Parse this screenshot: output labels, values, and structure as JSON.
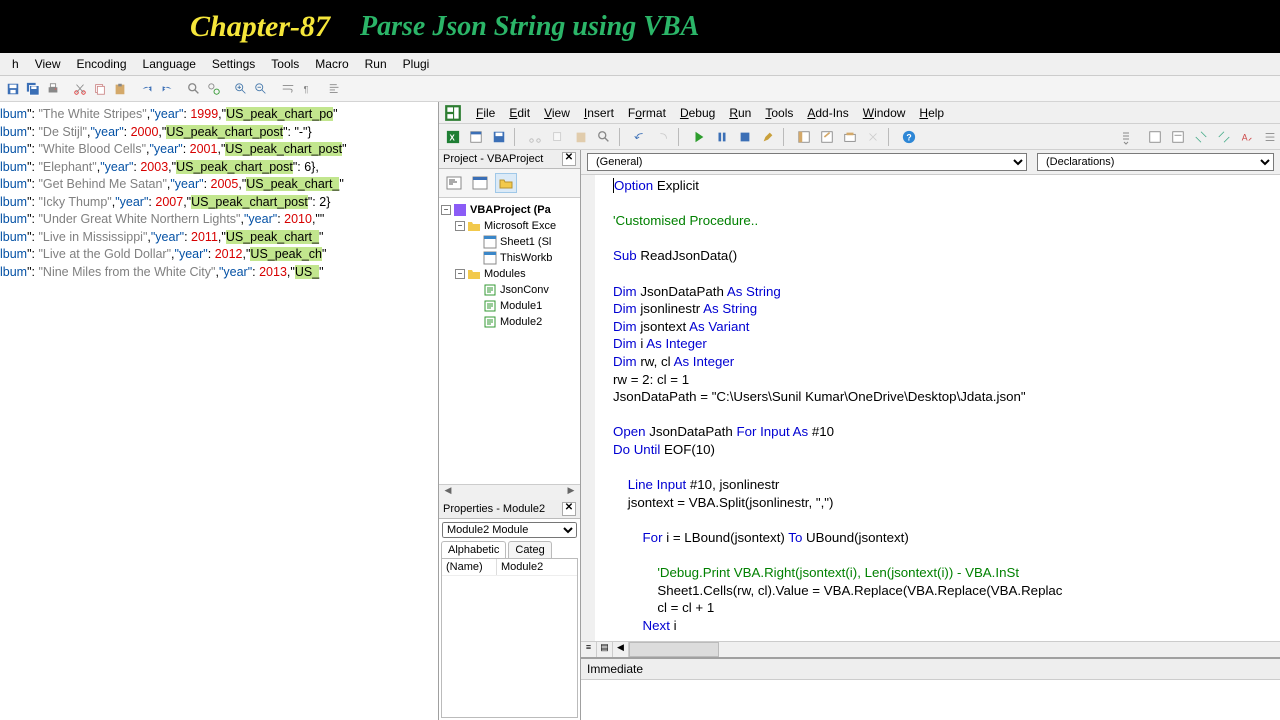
{
  "header": {
    "chapter": "Chapter-87",
    "subtitle": "Parse Json String using VBA"
  },
  "npp": {
    "menus": [
      "h",
      "View",
      "Encoding",
      "Language",
      "Settings",
      "Tools",
      "Macro",
      "Run",
      "Plugi"
    ],
    "json_lines": [
      {
        "key": "lbum",
        "album": "The White Stripes",
        "year": 1999,
        "peak_hl": "US_peak_chart_po"
      },
      {
        "key": "lbum",
        "album": "De Stijl",
        "year": 2000,
        "peak_hl": "US_peak_chart_post",
        "tail": ": \"-\"}"
      },
      {
        "key": "lbum",
        "album": "White Blood Cells",
        "year": 2001,
        "peak_hl": "US_peak_chart_post"
      },
      {
        "key": "lbum",
        "album": "Elephant",
        "year": 2003,
        "peak_hl": "US_peak_chart_post",
        "tail": ": 6},"
      },
      {
        "key": "lbum",
        "album": "Get Behind Me Satan",
        "year": 2005,
        "peak_hl": "US_peak_chart_"
      },
      {
        "key": "lbum",
        "album": "Icky Thump",
        "year": 2007,
        "peak_hl": "US_peak_chart_post",
        "tail": ": 2}"
      },
      {
        "key": "lbum",
        "album": "Under Great White Northern Lights",
        "year": 2010,
        "tail_hl": ""
      },
      {
        "key": "lbum",
        "album": "Live in Mississippi",
        "year": 2011,
        "peak_hl": "US_peak_chart_"
      },
      {
        "key": "lbum",
        "album": "Live at the Gold Dollar",
        "year": 2012,
        "peak_hl": "US_peak_ch"
      },
      {
        "key": "lbum",
        "album": "Nine Miles from the White City",
        "year": 2013,
        "peak_hl": "US_"
      }
    ]
  },
  "vbe": {
    "menus": [
      "File",
      "Edit",
      "View",
      "Insert",
      "Format",
      "Debug",
      "Run",
      "Tools",
      "Add-Ins",
      "Window",
      "Help"
    ],
    "project_title": "Project - VBAProject",
    "tree": {
      "root": "VBAProject (Pa",
      "excel_folder": "Microsoft Exce",
      "sheet1": "Sheet1 (Sl",
      "thiswb": "ThisWorkb",
      "modules": "Modules",
      "mod_items": [
        "JsonConv",
        "Module1",
        "Module2"
      ]
    },
    "properties_title": "Properties - Module2",
    "props_combo": "Module2 Module",
    "props_tabs": [
      "Alphabetic",
      "Categ"
    ],
    "props_name_k": "(Name)",
    "props_name_v": "Module2",
    "combo_left": "(General)",
    "combo_right": "(Declarations)",
    "immediate_title": "Immediate",
    "code": {
      "l1_a": "Option",
      "l1_b": " Explicit",
      "l2": "'Customised Procedure..",
      "l3_a": "Sub",
      "l3_b": " ReadJsonData()",
      "l4_a": "Dim",
      "l4_b": " JsonDataPath ",
      "l4_c": "As String",
      "l5_a": "Dim",
      "l5_b": " jsonlinestr ",
      "l5_c": "As String",
      "l6_a": "Dim",
      "l6_b": " jsontext ",
      "l6_c": "As Variant",
      "l7_a": "Dim",
      "l7_b": " i ",
      "l7_c": "As Integer",
      "l8_a": "Dim",
      "l8_b": " rw, cl ",
      "l8_c": "As Integer",
      "l9": "rw = 2: cl = 1",
      "l10_a": "JsonDataPath = ",
      "l10_b": "\"C:\\Users\\Sunil Kumar\\OneDrive\\Desktop\\Jdata.json\"",
      "l11_a": "Open",
      "l11_b": " JsonDataPath ",
      "l11_c": "For Input As",
      "l11_d": " #10",
      "l12_a": "Do Until",
      "l12_b": " EOF(10)",
      "l13_a": "    Line Input",
      "l13_b": " #10, jsonlinestr",
      "l14_a": "    jsontext = VBA.Split(jsonlinestr, ",
      "l14_b": "\",\"",
      "l14_c": ")",
      "l15_a": "        For",
      "l15_b": " i = LBound(jsontext) ",
      "l15_c": "To",
      "l15_d": " UBound(jsontext)",
      "l16": "            'Debug.Print VBA.Right(jsontext(i), Len(jsontext(i)) - VBA.InSt",
      "l17": "            Sheet1.Cells(rw, cl).Value = VBA.Replace(VBA.Replace(VBA.Replac",
      "l18": "            cl = cl + 1",
      "l19_a": "        Next",
      "l19_b": " i"
    }
  }
}
